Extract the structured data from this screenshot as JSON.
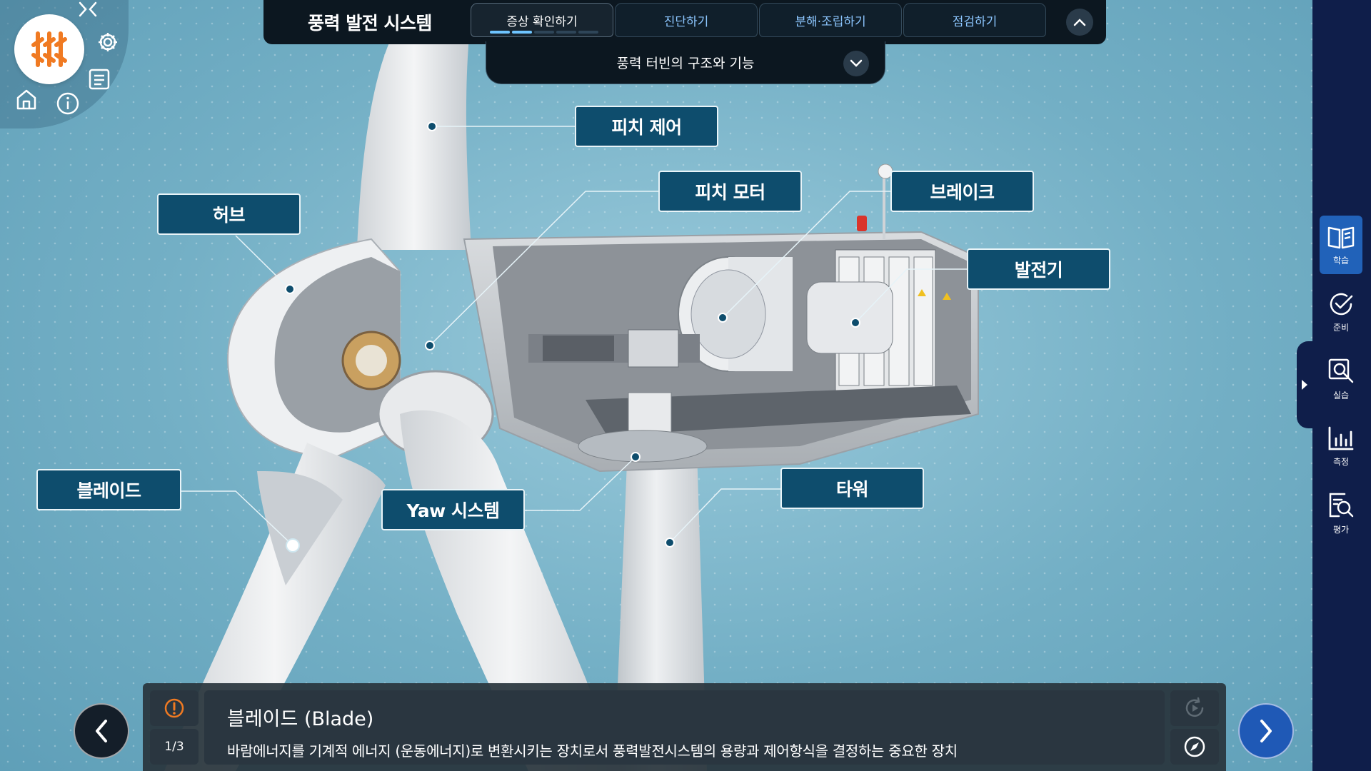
{
  "app_title": "풍력 발전 시스템",
  "tabs": [
    {
      "label": "증상 확인하기",
      "active": true
    },
    {
      "label": "진단하기",
      "active": false
    },
    {
      "label": "분해·조립하기",
      "active": false
    },
    {
      "label": "점검하기",
      "active": false
    }
  ],
  "progress": {
    "completed_segments": 2,
    "total_segments": 5
  },
  "chapter_title": "풍력 터빈의 구조와 기능",
  "callouts": {
    "pitch_control": "피치 제어",
    "pitch_motor": "피치 모터",
    "brake": "브레이크",
    "hub": "허브",
    "generator": "발전기",
    "blade": "블레이드",
    "yaw_system": "Yaw 시스템",
    "tower": "타워"
  },
  "sidebar": [
    {
      "label": "학습",
      "icon": "book-icon",
      "active": true
    },
    {
      "label": "준비",
      "icon": "check-circle-icon",
      "active": false
    },
    {
      "label": "실습",
      "icon": "magnify-tool-icon",
      "active": false
    },
    {
      "label": "측정",
      "icon": "bar-chart-icon",
      "active": false
    },
    {
      "label": "평가",
      "icon": "report-search-icon",
      "active": false
    }
  ],
  "info": {
    "title": "블레이드 (Blade)",
    "description": "바람에너지를 기계적 에너지 (운동에너지)로 변환시키는 장치로서 풍력발전시스템의 용량과 제어항식을 결정하는 중요한 장치",
    "page": "1/3"
  },
  "colors": {
    "label_bg": "#0e4d6d",
    "sidebar_bg": "#0f1e4a",
    "sidebar_active": "#2162b9",
    "logo_orange": "#f07a22",
    "next_button": "#1f59b6"
  }
}
